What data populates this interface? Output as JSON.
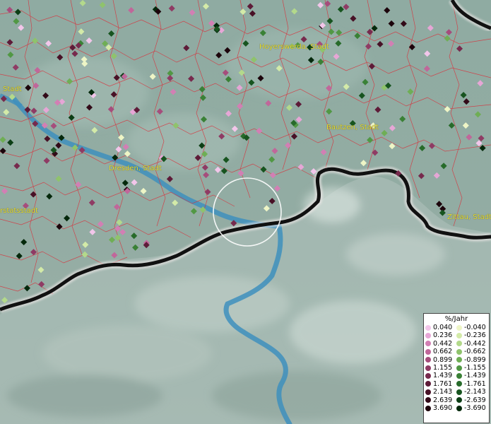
{
  "map": {
    "cities": [
      {
        "name": "Hoyerswerda, Stadt"
      },
      {
        "name": "Stadt"
      },
      {
        "name": "Bautzen, Stadt"
      },
      {
        "name": "Dresden, Stadt"
      },
      {
        "name": "rstatsstadt"
      },
      {
        "name": "Zittau, Stadt"
      }
    ]
  },
  "legend": {
    "title": "%/Jahr",
    "positive": [
      {
        "label": "0.040",
        "color": "#f2c6ea"
      },
      {
        "label": "0.236",
        "color": "#e6a6d6"
      },
      {
        "label": "0.442",
        "color": "#d27fb4"
      },
      {
        "label": "0.662",
        "color": "#c0679a"
      },
      {
        "label": "0.899",
        "color": "#a64d7c"
      },
      {
        "label": "1.155",
        "color": "#8f3b64"
      },
      {
        "label": "1.439",
        "color": "#772a4d"
      },
      {
        "label": "1.761",
        "color": "#5e1b38"
      },
      {
        "label": "2.143",
        "color": "#481126"
      },
      {
        "label": "2.639",
        "color": "#320a18"
      },
      {
        "label": "3.690",
        "color": "#1c040b"
      }
    ],
    "negative": [
      {
        "label": "-0.040",
        "color": "#eef5c6"
      },
      {
        "label": "-0.236",
        "color": "#d3eaa8"
      },
      {
        "label": "-0.442",
        "color": "#b3d98b"
      },
      {
        "label": "-0.662",
        "color": "#8fc36c"
      },
      {
        "label": "-0.899",
        "color": "#6fae55"
      },
      {
        "label": "-1.155",
        "color": "#519844"
      },
      {
        "label": "-1.439",
        "color": "#3a8136"
      },
      {
        "label": "-1.761",
        "color": "#276b2a"
      },
      {
        "label": "-2.143",
        "color": "#17541f"
      },
      {
        "label": "-2.639",
        "color": "#0c3e15"
      },
      {
        "label": "-3.690",
        "color": "#04280b"
      }
    ]
  }
}
